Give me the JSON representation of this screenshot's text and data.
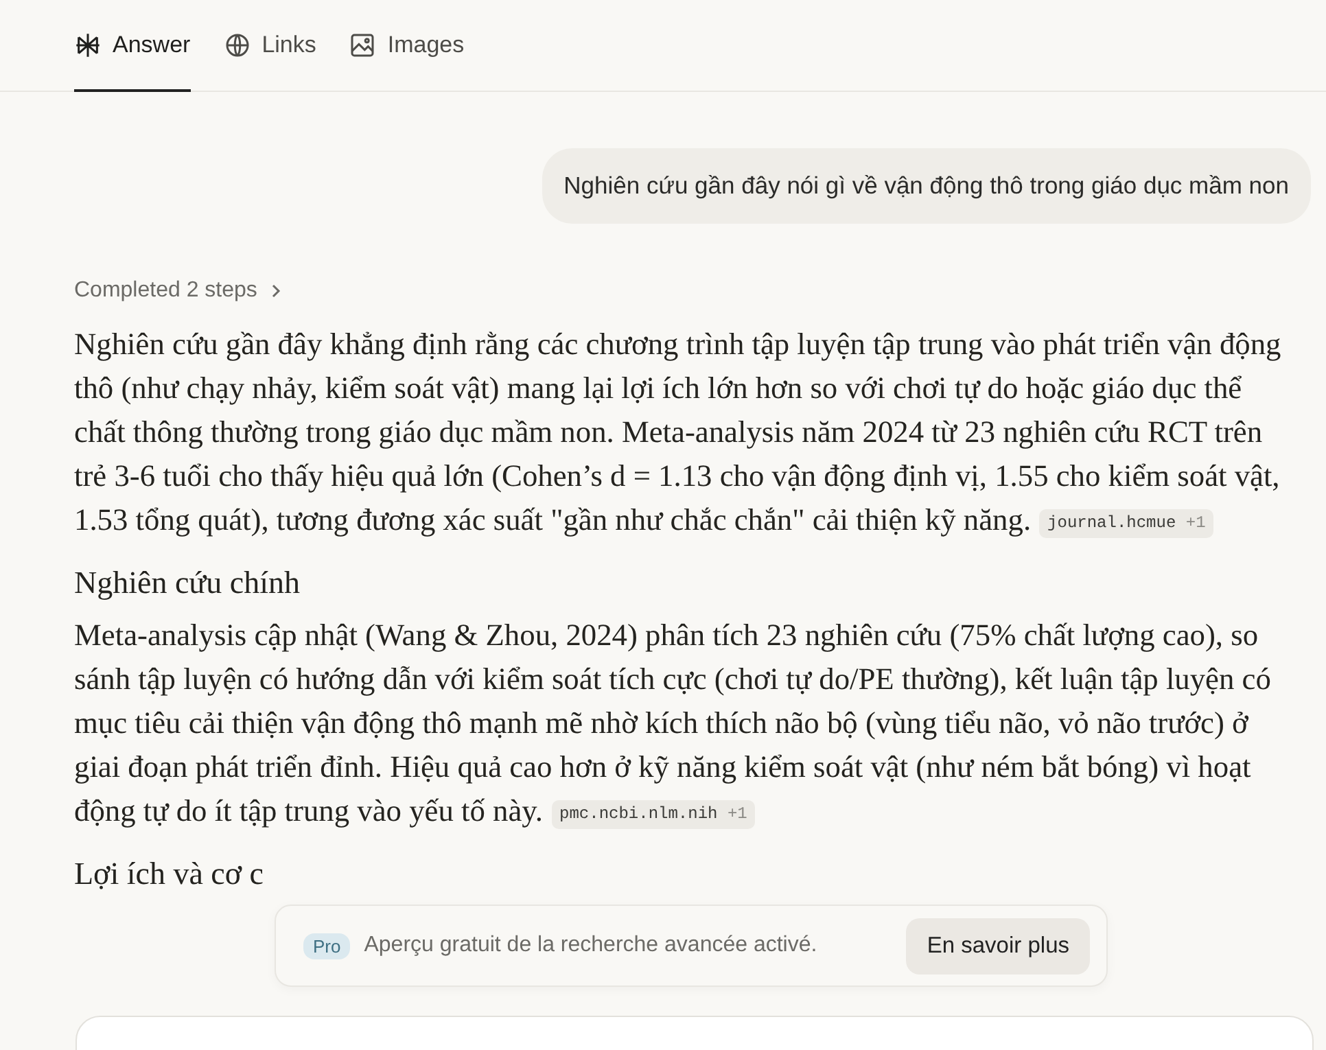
{
  "tabs": [
    {
      "label": "Answer",
      "kind": "answer",
      "selected": true
    },
    {
      "label": "Links",
      "kind": "globe",
      "selected": false
    },
    {
      "label": "Images",
      "kind": "image",
      "selected": false
    }
  ],
  "question": "Nghiên cứu gần đây nói gì về vận động thô trong giáo dục mầm non",
  "steps": "Completed 2 steps",
  "blocks": [
    {
      "kind": "paragraph",
      "text": "Nghiên cứu gần đây khẳng định rằng các chương trình tập luyện tập trung vào phát triển vận động thô (như chạy nhảy, kiểm soát vật) mang lại lợi ích lớn hơn so với chơi tự do hoặc giáo dục thể chất thông thường trong giáo dục mầm non. Meta-analysis năm 2024 từ 23 nghiên cứu RCT trên trẻ 3-6 tuổi cho thấy hiệu quả lớn (Cohen’s d = 1.13 cho vận động định vị, 1.55 cho kiểm soát vật, 1.53 tổng quát), tương đương xác suất \"gần như chắc chắn\" cải thiện kỹ năng.",
      "source": "journal.hcmue",
      "more": "+1"
    },
    {
      "kind": "heading",
      "text": "Nghiên cứu chính"
    },
    {
      "kind": "paragraph",
      "text": "Meta-analysis cập nhật (Wang & Zhou, 2024) phân tích 23 nghiên cứu (75% chất lượng cao), so sánh tập luyện có hướng dẫn với kiểm soát tích cực (chơi tự do/PE thường), kết luận tập luyện có mục tiêu cải thiện vận động thô mạnh mẽ nhờ kích thích não bộ (vùng tiểu não, vỏ não trước) ở giai đoạn phát triển đỉnh. Hiệu quả cao hơn ở kỹ năng kiểm soát vật (như ném bắt bóng) vì hoạt động tự do ít tập trung vào yếu tố này.",
      "source": "pmc.ncbi.nlm.nih",
      "more": "+1"
    },
    {
      "kind": "heading",
      "text": "Lợi ích và cơ c"
    }
  ],
  "toast": {
    "badge": "Pro",
    "message": "Aperçu gratuit de la recherche avancée activé.",
    "button": "En savoir plus"
  }
}
